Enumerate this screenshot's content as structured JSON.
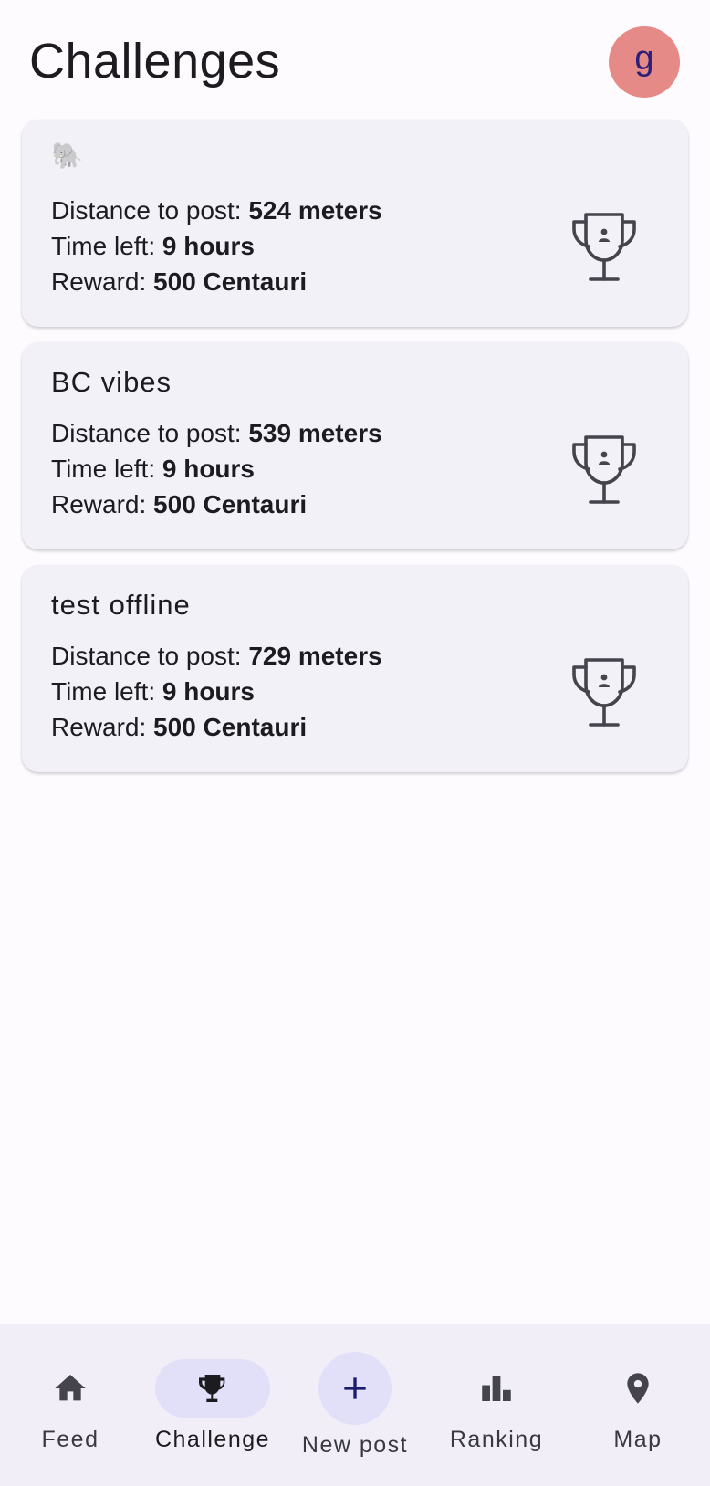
{
  "header": {
    "title": "Challenges",
    "avatar_initial": "g"
  },
  "challenges": [
    {
      "title": "🐘",
      "distance_label": "Distance to post: ",
      "distance_value": "524 meters",
      "time_label": "Time left: ",
      "time_value": "9 hours",
      "reward_label": "Reward: ",
      "reward_value": "500 Centauri",
      "icon": "trophy-icon"
    },
    {
      "title": "BC vibes",
      "distance_label": "Distance to post: ",
      "distance_value": "539 meters",
      "time_label": "Time left: ",
      "time_value": "9 hours",
      "reward_label": "Reward: ",
      "reward_value": "500 Centauri",
      "icon": "trophy-icon"
    },
    {
      "title": "test offline",
      "distance_label": "Distance to post: ",
      "distance_value": "729 meters",
      "time_label": "Time left: ",
      "time_value": "9 hours",
      "reward_label": "Reward: ",
      "reward_value": "500 Centauri",
      "icon": "trophy-icon"
    }
  ],
  "nav": {
    "items": [
      {
        "label": "Feed",
        "icon": "home-icon"
      },
      {
        "label": "Challenge",
        "icon": "trophy-icon",
        "active": true
      },
      {
        "label": "New post",
        "icon": "plus-icon"
      },
      {
        "label": "Ranking",
        "icon": "bar-chart-icon"
      },
      {
        "label": "Map",
        "icon": "location-pin-icon"
      }
    ]
  },
  "colors": {
    "background": "#fefbff",
    "card": "#f3f1f8",
    "avatar": "#e68a87",
    "nav_background": "#f1eef8",
    "nav_active": "#e2e0f9",
    "accent": "#1b1b6b"
  }
}
